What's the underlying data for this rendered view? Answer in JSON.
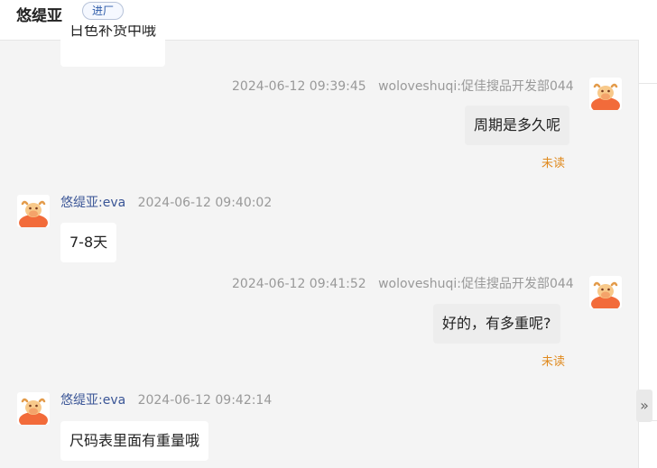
{
  "header": {
    "title": "悠缇亚",
    "badge": "进厂"
  },
  "messages": [
    {
      "side": "left",
      "text": "日色补货中哦",
      "partial": true
    },
    {
      "side": "right",
      "time": "2024-06-12 09:39:45",
      "sender": "woloveshuqi:促佳搜品开发部044",
      "text": "周期是多久呢",
      "status": "未读"
    },
    {
      "side": "left",
      "sender": "悠缇亚:eva",
      "time": "2024-06-12 09:40:02",
      "text": "7-8天"
    },
    {
      "side": "right",
      "time": "2024-06-12 09:41:52",
      "sender": "woloveshuqi:促佳搜品开发部044",
      "text": "好的，有多重呢?",
      "status": "未读"
    },
    {
      "side": "left",
      "sender": "悠缇亚:eva",
      "time": "2024-06-12 09:42:14",
      "text": "尺码表里面有重量哦"
    }
  ],
  "icons": {
    "avatar": "cartoon-cow-avatar-icon",
    "expand": "double-chevron-right-icon"
  },
  "colors": {
    "sender_link": "#3a5596",
    "unread": "#e08a1e",
    "badge": "#2c5aa8"
  },
  "ui": {
    "expand_glyph": "»"
  }
}
